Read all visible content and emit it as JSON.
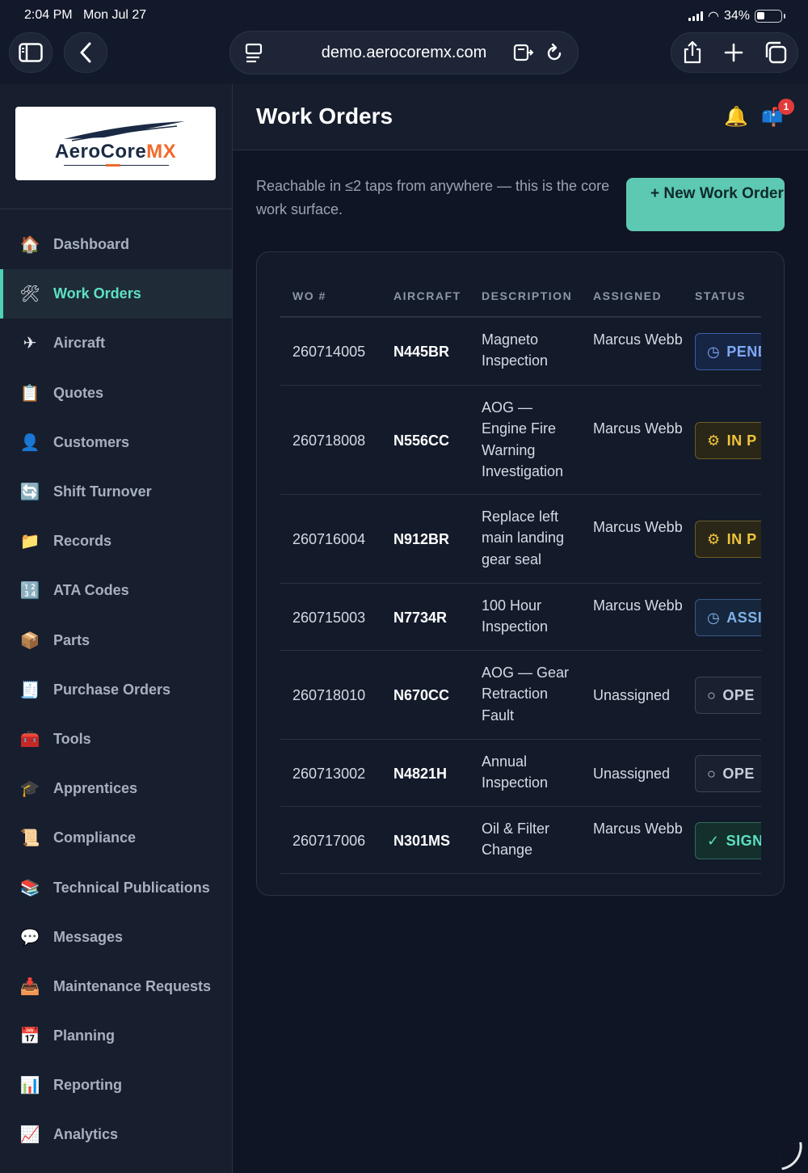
{
  "status_bar": {
    "time": "2:04 PM",
    "date": "Mon Jul 27",
    "battery": "34%"
  },
  "browser": {
    "url": "demo.aerocoremx.com"
  },
  "logo": {
    "text_a": "AeroCore",
    "text_b": "MX"
  },
  "sidebar": {
    "items": [
      {
        "label": "Dashboard",
        "icon": "house-icon",
        "glyph": "🏠",
        "active": false
      },
      {
        "label": "Work Orders",
        "icon": "tools-icon",
        "glyph": "🛠",
        "active": true
      },
      {
        "label": "Aircraft",
        "icon": "airplane-icon",
        "glyph": "✈",
        "active": false
      },
      {
        "label": "Quotes",
        "icon": "clipboard-icon",
        "glyph": "📋",
        "active": false
      },
      {
        "label": "Customers",
        "icon": "person-icon",
        "glyph": "👤",
        "active": false
      },
      {
        "label": "Shift Turnover",
        "icon": "cycle-icon",
        "glyph": "🔄",
        "active": false
      },
      {
        "label": "Records",
        "icon": "folder-icon",
        "glyph": "📁",
        "active": false
      },
      {
        "label": "ATA Codes",
        "icon": "numbers-icon",
        "glyph": "🔢",
        "active": false
      },
      {
        "label": "Parts",
        "icon": "package-icon",
        "glyph": "📦",
        "active": false
      },
      {
        "label": "Purchase Orders",
        "icon": "receipt-icon",
        "glyph": "🧾",
        "active": false
      },
      {
        "label": "Tools",
        "icon": "toolbox-icon",
        "glyph": "🧰",
        "active": false
      },
      {
        "label": "Apprentices",
        "icon": "graduation-cap-icon",
        "glyph": "🎓",
        "active": false
      },
      {
        "label": "Compliance",
        "icon": "scroll-icon",
        "glyph": "📜",
        "active": false
      },
      {
        "label": "Technical Publications",
        "icon": "books-icon",
        "glyph": "📚",
        "active": false
      },
      {
        "label": "Messages",
        "icon": "speech-bubble-icon",
        "glyph": "💬",
        "active": false
      },
      {
        "label": "Maintenance Requests",
        "icon": "inbox-icon",
        "glyph": "📥",
        "active": false
      },
      {
        "label": "Planning",
        "icon": "calendar-icon",
        "glyph": "📅",
        "active": false
      },
      {
        "label": "Reporting",
        "icon": "bar-chart-icon",
        "glyph": "📊",
        "active": false
      },
      {
        "label": "Analytics",
        "icon": "line-chart-icon",
        "glyph": "📈",
        "active": false
      }
    ]
  },
  "header": {
    "title": "Work Orders",
    "notification_count": "1"
  },
  "main": {
    "intro": "Reachable in ≤2 taps from anywhere — this is the core work surface.",
    "new_button": "+ New Work Order"
  },
  "table": {
    "columns": [
      "WO #",
      "AIRCRAFT",
      "DESCRIPTION",
      "ASSIGNED",
      "STATUS"
    ],
    "rows": [
      {
        "wo": "260714005",
        "aircraft": "N445BR",
        "description": "Magneto Inspection",
        "assigned": "Marcus Webb",
        "status": "PEND",
        "status_icon": "clock-icon",
        "status_glyph": "◷",
        "status_class": "st-pending"
      },
      {
        "wo": "260718008",
        "aircraft": "N556CC",
        "description": "AOG — Engine Fire Warning Investigation",
        "assigned": "Marcus Webb",
        "status": "IN P",
        "status_icon": "gear-icon",
        "status_glyph": "⚙",
        "status_class": "st-progress"
      },
      {
        "wo": "260716004",
        "aircraft": "N912BR",
        "description": "Replace left main landing gear seal",
        "assigned": "Marcus Webb",
        "status": "IN P",
        "status_icon": "gear-icon",
        "status_glyph": "⚙",
        "status_class": "st-progress"
      },
      {
        "wo": "260715003",
        "aircraft": "N7734R",
        "description": "100 Hour Inspection",
        "assigned": "Marcus Webb",
        "status": "ASSI",
        "status_icon": "clock-icon",
        "status_glyph": "◷",
        "status_class": "st-assigned"
      },
      {
        "wo": "260718010",
        "aircraft": "N670CC",
        "description": "AOG — Gear Retraction Fault",
        "assigned": "Unassigned",
        "status": "OPE",
        "status_icon": "circle-icon",
        "status_glyph": "○",
        "status_class": "st-open"
      },
      {
        "wo": "260713002",
        "aircraft": "N4821H",
        "description": "Annual Inspection",
        "assigned": "Unassigned",
        "status": "OPE",
        "status_icon": "circle-icon",
        "status_glyph": "○",
        "status_class": "st-open"
      },
      {
        "wo": "260717006",
        "aircraft": "N301MS",
        "description": "Oil & Filter Change",
        "assigned": "Marcus Webb",
        "status": "SIGN",
        "status_icon": "check-icon",
        "status_glyph": "✓",
        "status_class": "st-signed"
      }
    ]
  }
}
